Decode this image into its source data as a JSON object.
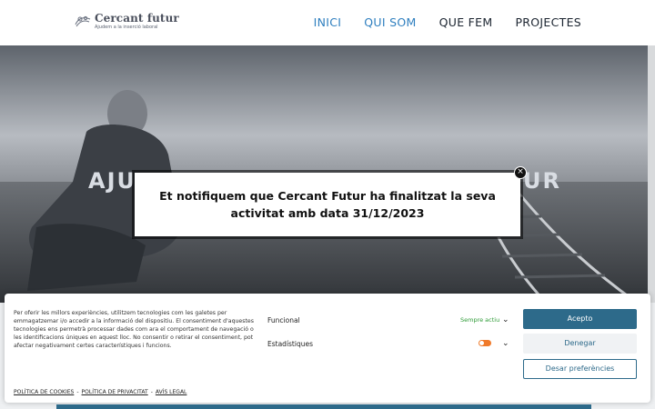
{
  "header": {
    "logo_title": "Cercant futur",
    "logo_subtitle": "Ajudem a la inserció laboral",
    "nav": [
      {
        "label": "INICI"
      },
      {
        "label": "QUI SOM"
      },
      {
        "label": "QUE FEM"
      },
      {
        "label": "PROJECTES"
      }
    ]
  },
  "hero": {
    "title_left": "AJU",
    "title_right": "UR"
  },
  "modal": {
    "message": "Et notifiquem que Cercant Futur ha finalitzat la seva activitat amb data 31/12/2023",
    "close_symbol": "×"
  },
  "cookie_banner": {
    "description": "Per oferir les millors experiències, utilitzem tecnologies com les galetes per emmagatzemar i/o accedir a la informació del dispositiu. El consentiment d'aquestes tecnologies ens permetrà processar dades com ara el comportament de navegació o les identificacions úniques en aquest lloc. No consentir o retirar el consentiment, pot afectar negativament certes característiques i funcions.",
    "categories": [
      {
        "label": "Funcional",
        "status": "Sempre actiu"
      },
      {
        "label": "Estadístiques"
      }
    ],
    "buttons": {
      "accept": "Acepto",
      "deny": "Denegar",
      "preferences": "Desar preferències"
    },
    "links": {
      "cookies": "POLÍTICA DE COOKIES",
      "privacy": "POLÍTICA DE PRIVACITAT",
      "legal": "AVÍS LEGAL",
      "separator": "-"
    }
  },
  "colors": {
    "accent": "#2d6a8a",
    "nav_active": "#2f7fbf",
    "toggle_on": "#f07a2a",
    "always_active": "#2e9b37"
  }
}
